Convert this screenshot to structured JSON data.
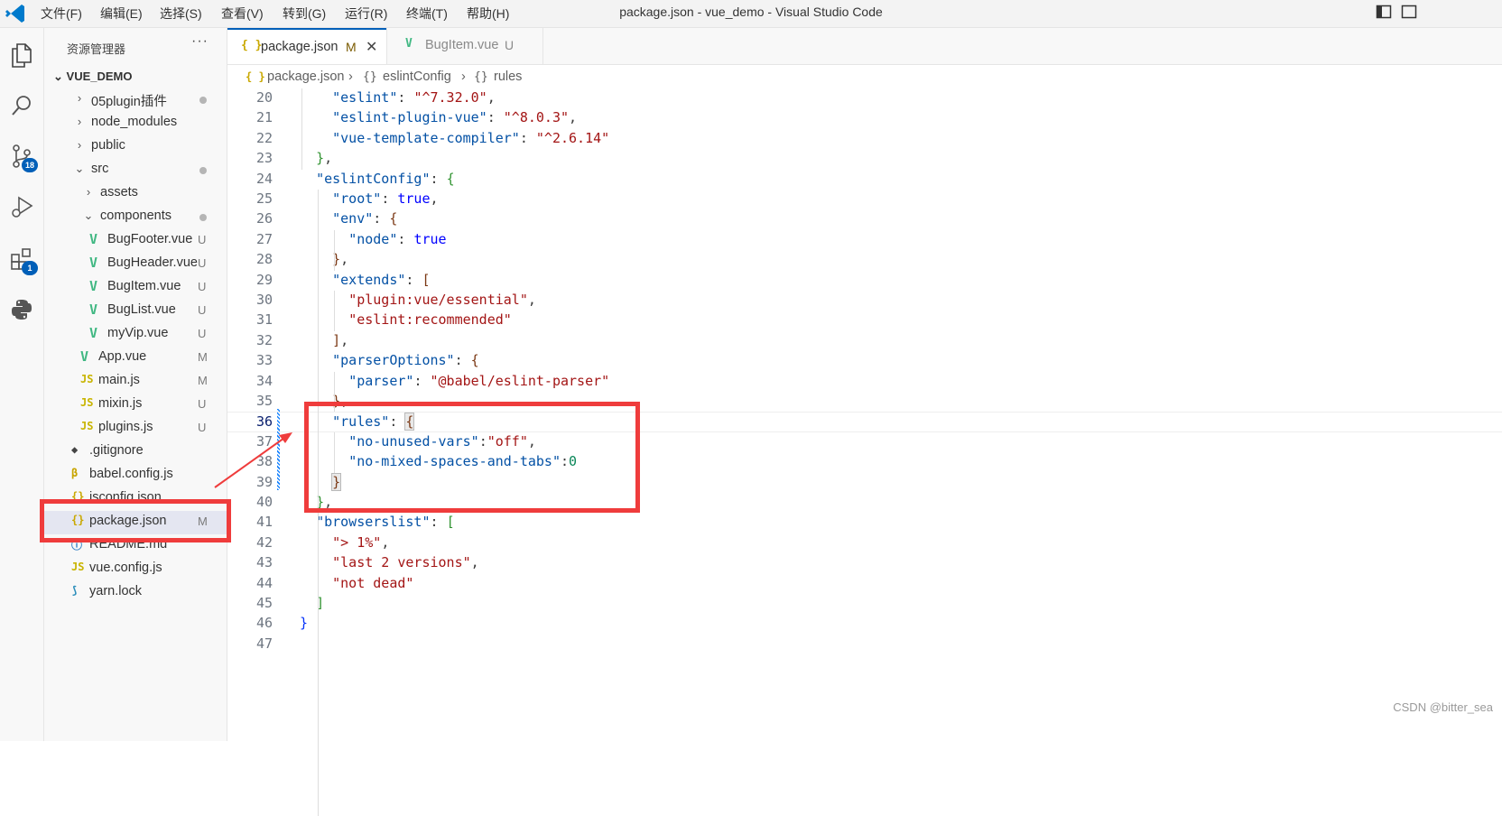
{
  "window_title": "package.json - vue_demo - Visual Studio Code",
  "menu": [
    "文件(F)",
    "编辑(E)",
    "选择(S)",
    "查看(V)",
    "转到(G)",
    "运行(R)",
    "终端(T)",
    "帮助(H)"
  ],
  "activity_bar": {
    "items": [
      "explorer-icon",
      "search-icon",
      "source-control-icon",
      "run-debug-icon",
      "extensions-icon",
      "python-icon"
    ],
    "source_control_badge": "18",
    "extensions_badge": "1"
  },
  "explorer": {
    "header": "资源管理器",
    "more": "···",
    "project": "VUE_DEMO",
    "items": [
      {
        "label": "05plugin插件",
        "kind": "folder",
        "expanded": false,
        "status": "dot"
      },
      {
        "label": "node_modules",
        "kind": "folder",
        "expanded": false,
        "status": ""
      },
      {
        "label": "public",
        "kind": "folder",
        "expanded": false,
        "status": ""
      },
      {
        "label": "src",
        "kind": "folder",
        "expanded": true,
        "status": "dot"
      },
      {
        "label": "assets",
        "kind": "folder",
        "expanded": false,
        "status": ""
      },
      {
        "label": "components",
        "kind": "folder",
        "expanded": true,
        "status": "dot"
      },
      {
        "label": "BugFooter.vue",
        "kind": "vue",
        "status": "U"
      },
      {
        "label": "BugHeader.vue",
        "kind": "vue",
        "status": "U"
      },
      {
        "label": "BugItem.vue",
        "kind": "vue",
        "status": "U"
      },
      {
        "label": "BugList.vue",
        "kind": "vue",
        "status": "U"
      },
      {
        "label": "myVip.vue",
        "kind": "vue",
        "status": "U"
      },
      {
        "label": "App.vue",
        "kind": "vue",
        "status": "M"
      },
      {
        "label": "main.js",
        "kind": "js",
        "status": "M"
      },
      {
        "label": "mixin.js",
        "kind": "js",
        "status": "U"
      },
      {
        "label": "plugins.js",
        "kind": "js",
        "status": "U"
      },
      {
        "label": ".gitignore",
        "kind": "git",
        "status": ""
      },
      {
        "label": "babel.config.js",
        "kind": "babel",
        "status": ""
      },
      {
        "label": "jsconfig.json",
        "kind": "json",
        "status": ""
      },
      {
        "label": "package.json",
        "kind": "json",
        "status": "M",
        "selected": true
      },
      {
        "label": "README.md",
        "kind": "info",
        "status": ""
      },
      {
        "label": "vue.config.js",
        "kind": "js",
        "status": ""
      },
      {
        "label": "yarn.lock",
        "kind": "yarn",
        "status": ""
      }
    ]
  },
  "tabs": [
    {
      "label": "package.json",
      "status": "M",
      "icon": "{ }",
      "active": true
    },
    {
      "label": "BugItem.vue",
      "status": "U",
      "icon": "V",
      "active": false
    }
  ],
  "breadcrumb": [
    "package.json",
    "eslintConfig",
    "rules"
  ],
  "editor": {
    "current_line": 36,
    "lines": [
      {
        "n": "20",
        "code": [
          [
            "    ",
            ""
          ],
          [
            "\"eslint\"",
            "k"
          ],
          [
            ": ",
            ""
          ],
          [
            "\"^7.32.0\"",
            "s"
          ],
          [
            ",",
            ""
          ]
        ]
      },
      {
        "n": "21",
        "code": [
          [
            "    ",
            ""
          ],
          [
            "\"eslint-plugin-vue\"",
            "k"
          ],
          [
            ": ",
            ""
          ],
          [
            "\"^8.0.3\"",
            "s"
          ],
          [
            ",",
            ""
          ]
        ]
      },
      {
        "n": "22",
        "code": [
          [
            "    ",
            ""
          ],
          [
            "\"vue-template-compiler\"",
            "k"
          ],
          [
            ": ",
            ""
          ],
          [
            "\"^2.6.14\"",
            "s"
          ]
        ]
      },
      {
        "n": "23",
        "code": [
          [
            "  ",
            ""
          ],
          [
            "}",
            "br2"
          ],
          [
            ",",
            ""
          ]
        ]
      },
      {
        "n": "24",
        "code": [
          [
            "  ",
            ""
          ],
          [
            "\"eslintConfig\"",
            "k"
          ],
          [
            ": ",
            ""
          ],
          [
            "{",
            "br2"
          ]
        ]
      },
      {
        "n": "25",
        "code": [
          [
            "    ",
            ""
          ],
          [
            "\"root\"",
            "k"
          ],
          [
            ": ",
            ""
          ],
          [
            "true",
            "b"
          ],
          [
            ",",
            ""
          ]
        ]
      },
      {
        "n": "26",
        "code": [
          [
            "    ",
            ""
          ],
          [
            "\"env\"",
            "k"
          ],
          [
            ": ",
            ""
          ],
          [
            "{",
            "br3"
          ]
        ]
      },
      {
        "n": "27",
        "code": [
          [
            "      ",
            ""
          ],
          [
            "\"node\"",
            "k"
          ],
          [
            ": ",
            ""
          ],
          [
            "true",
            "b"
          ]
        ]
      },
      {
        "n": "28",
        "code": [
          [
            "    ",
            ""
          ],
          [
            "}",
            "br3"
          ],
          [
            ",",
            ""
          ]
        ]
      },
      {
        "n": "29",
        "code": [
          [
            "    ",
            ""
          ],
          [
            "\"extends\"",
            "k"
          ],
          [
            ": ",
            ""
          ],
          [
            "[",
            "br3"
          ]
        ]
      },
      {
        "n": "30",
        "code": [
          [
            "      ",
            ""
          ],
          [
            "\"plugin:vue/essential\"",
            "s"
          ],
          [
            ",",
            ""
          ]
        ]
      },
      {
        "n": "31",
        "code": [
          [
            "      ",
            ""
          ],
          [
            "\"eslint:recommended\"",
            "s"
          ]
        ]
      },
      {
        "n": "32",
        "code": [
          [
            "    ",
            ""
          ],
          [
            "]",
            "br3"
          ],
          [
            ",",
            ""
          ]
        ]
      },
      {
        "n": "33",
        "code": [
          [
            "    ",
            ""
          ],
          [
            "\"parserOptions\"",
            "k"
          ],
          [
            ": ",
            ""
          ],
          [
            "{",
            "br3"
          ]
        ]
      },
      {
        "n": "34",
        "code": [
          [
            "      ",
            ""
          ],
          [
            "\"parser\"",
            "k"
          ],
          [
            ": ",
            ""
          ],
          [
            "\"@babel/eslint-parser\"",
            "s"
          ]
        ]
      },
      {
        "n": "35",
        "code": [
          [
            "    ",
            ""
          ],
          [
            "}",
            "br3"
          ],
          [
            ",",
            ""
          ]
        ]
      },
      {
        "n": "36",
        "code": [
          [
            "    ",
            ""
          ],
          [
            "\"rules\"",
            "k"
          ],
          [
            ": ",
            ""
          ],
          [
            "{",
            "br3 brm"
          ]
        ]
      },
      {
        "n": "37",
        "code": [
          [
            "      ",
            ""
          ],
          [
            "\"no-unused-vars\"",
            "k"
          ],
          [
            ":",
            ""
          ],
          [
            "\"off\"",
            "s"
          ],
          [
            ",",
            ""
          ]
        ]
      },
      {
        "n": "38",
        "code": [
          [
            "      ",
            ""
          ],
          [
            "\"no-mixed-spaces-and-tabs\"",
            "k"
          ],
          [
            ":",
            ""
          ],
          [
            "0",
            "n"
          ]
        ]
      },
      {
        "n": "39",
        "code": [
          [
            "    ",
            ""
          ],
          [
            "}",
            "br3 brm"
          ]
        ]
      },
      {
        "n": "40",
        "code": [
          [
            "  ",
            ""
          ],
          [
            "}",
            "br2"
          ],
          [
            ",",
            ""
          ]
        ]
      },
      {
        "n": "41",
        "code": [
          [
            "  ",
            ""
          ],
          [
            "\"browserslist\"",
            "k"
          ],
          [
            ": ",
            ""
          ],
          [
            "[",
            "br2"
          ]
        ]
      },
      {
        "n": "42",
        "code": [
          [
            "    ",
            ""
          ],
          [
            "\"> 1%\"",
            "s"
          ],
          [
            ",",
            ""
          ]
        ]
      },
      {
        "n": "43",
        "code": [
          [
            "    ",
            ""
          ],
          [
            "\"last 2 versions\"",
            "s"
          ],
          [
            ",",
            ""
          ]
        ]
      },
      {
        "n": "44",
        "code": [
          [
            "    ",
            ""
          ],
          [
            "\"not dead\"",
            "s"
          ]
        ]
      },
      {
        "n": "45",
        "code": [
          [
            "  ",
            ""
          ],
          [
            "]",
            "br2"
          ]
        ]
      },
      {
        "n": "46",
        "code": [
          [
            "",
            ""
          ],
          [
            "}",
            "br1"
          ]
        ]
      },
      {
        "n": "47",
        "code": []
      }
    ]
  },
  "watermark": "CSDN @bitter_sea",
  "colors": {
    "annotation": "#ef3c3c",
    "accent": "#005fb8",
    "vue": "#41b883",
    "js": "#cbcb41"
  }
}
